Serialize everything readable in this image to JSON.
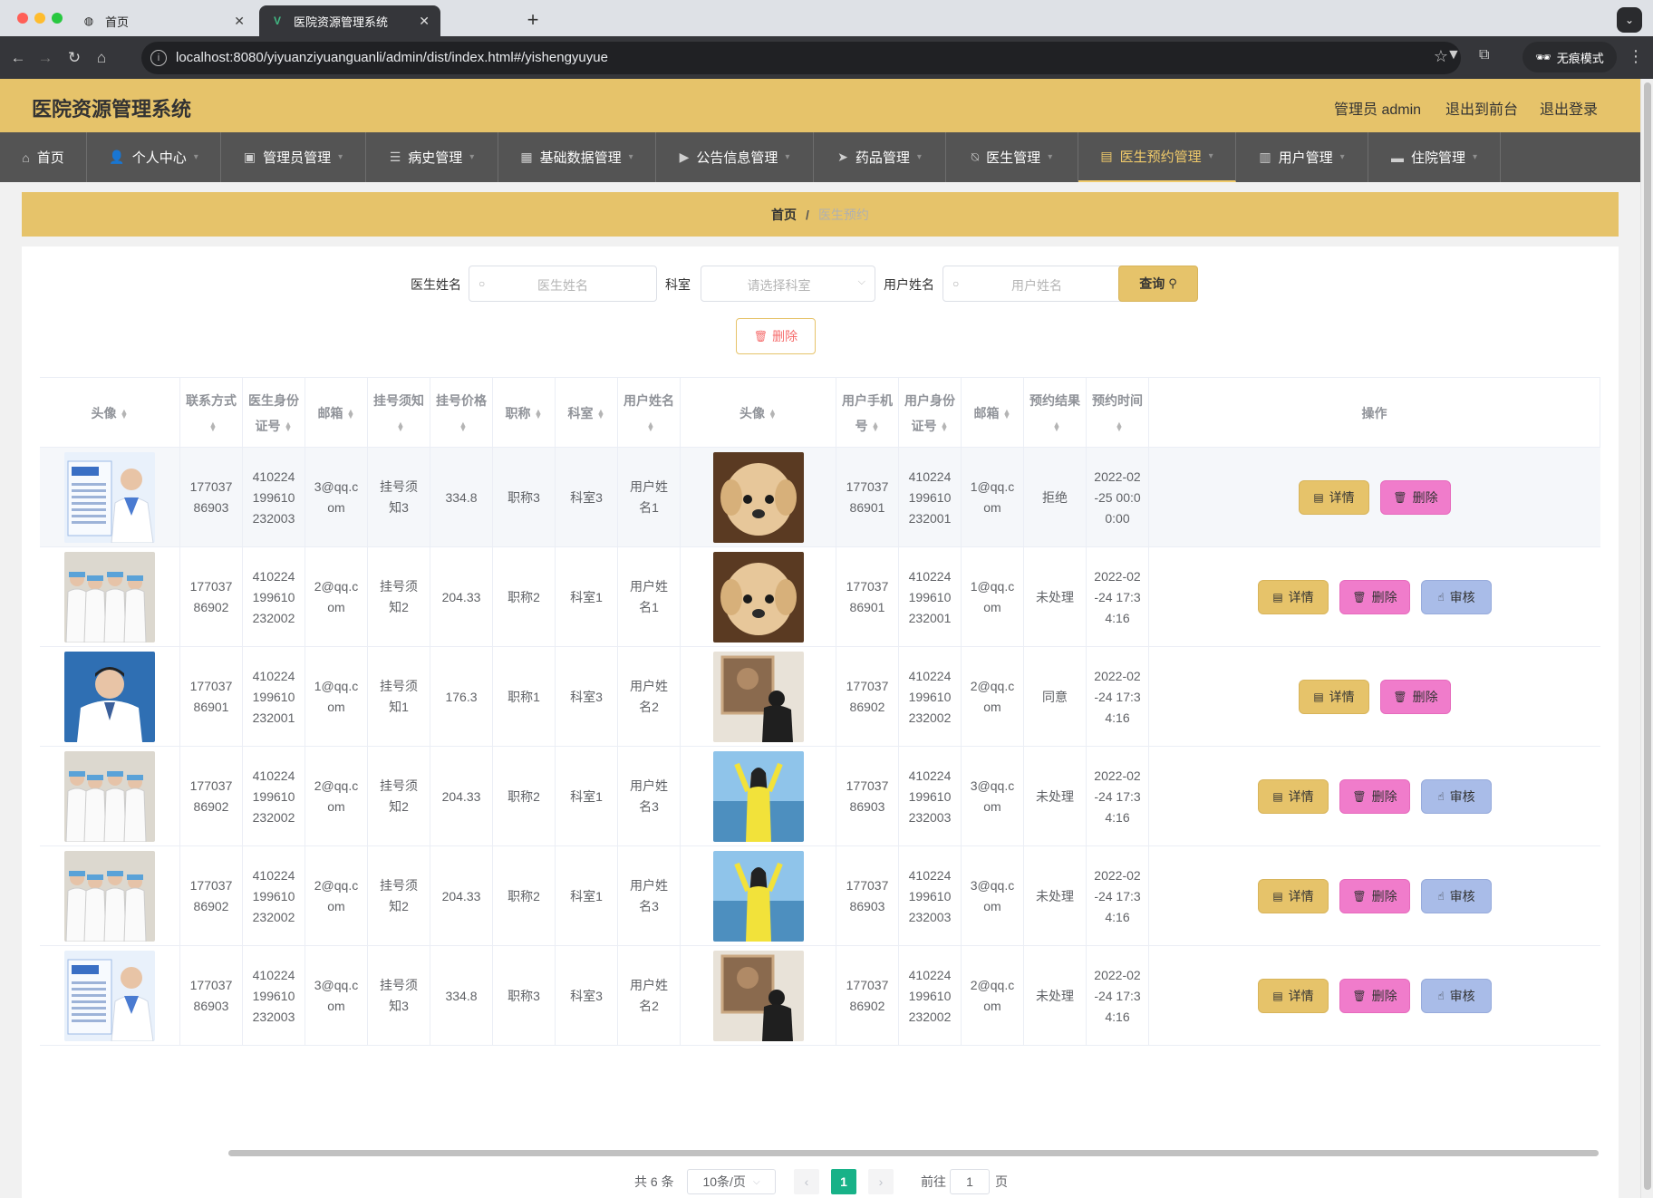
{
  "browser": {
    "tabs": [
      {
        "title": "首页",
        "active": false
      },
      {
        "title": "医院资源管理系统",
        "active": true
      }
    ],
    "url": "localhost:8080/yiyuanziyuanguanli/admin/dist/index.html#/yishengyuyue",
    "incognito_label": "无痕模式"
  },
  "header": {
    "title": "医院资源管理系统",
    "admin_label": "管理员 admin",
    "back_to_front": "退出到前台",
    "logout": "退出登录"
  },
  "nav": {
    "items": [
      {
        "label": "首页",
        "icon": "home-icon",
        "dropdown": false,
        "active": false
      },
      {
        "label": "个人中心",
        "icon": "user-icon",
        "dropdown": true,
        "active": false
      },
      {
        "label": "管理员管理",
        "icon": "admin-icon",
        "dropdown": true,
        "active": false
      },
      {
        "label": "病史管理",
        "icon": "list-icon",
        "dropdown": true,
        "active": false
      },
      {
        "label": "基础数据管理",
        "icon": "grid-icon",
        "dropdown": true,
        "active": false
      },
      {
        "label": "公告信息管理",
        "icon": "video-icon",
        "dropdown": true,
        "active": false
      },
      {
        "label": "药品管理",
        "icon": "send-icon",
        "dropdown": true,
        "active": false
      },
      {
        "label": "医生管理",
        "icon": "bell-off-icon",
        "dropdown": true,
        "active": false
      },
      {
        "label": "医生预约管理",
        "icon": "briefcase-icon",
        "dropdown": true,
        "active": true
      },
      {
        "label": "用户管理",
        "icon": "clipboard-icon",
        "dropdown": true,
        "active": false
      },
      {
        "label": "住院管理",
        "icon": "bed-icon",
        "dropdown": true,
        "active": false
      }
    ]
  },
  "breadcrumb": {
    "home": "首页",
    "separator": "/",
    "current": "医生预约"
  },
  "search": {
    "doctor_name_label": "医生姓名",
    "doctor_name_placeholder": "医生姓名",
    "dept_label": "科室",
    "dept_placeholder": "请选择科室",
    "user_name_label": "用户姓名",
    "user_name_placeholder": "用户姓名",
    "query_label": "查询"
  },
  "bulk_delete_label": "删除",
  "table": {
    "columns": [
      "头像",
      "联系方式",
      "医生身份证号",
      "邮箱",
      "挂号须知",
      "挂号价格",
      "职称",
      "科室",
      "用户姓名",
      "头像",
      "用户手机号",
      "用户身份证号",
      "邮箱",
      "预约结果",
      "预约时间",
      "操作"
    ],
    "actions": {
      "detail": "详情",
      "delete": "删除",
      "audit": "审核"
    },
    "rows": [
      {
        "doctor_avatar": "doctor-portrait-poster",
        "phone": "17703786903",
        "doctor_id": "410224199610232003",
        "email": "3@qq.com",
        "notice": "挂号须知3",
        "price": "334.8",
        "title": "职称3",
        "dept": "科室3",
        "user_name": "用户姓名1",
        "user_avatar": "puppy-photo",
        "user_phone": "17703786901",
        "user_id": "410224199610232001",
        "user_email": "1@qq.com",
        "result": "拒绝",
        "time": "2022-02-25 00:00:00",
        "can_audit": false
      },
      {
        "doctor_avatar": "nurses-group-photo",
        "phone": "17703786902",
        "doctor_id": "410224199610232002",
        "email": "2@qq.com",
        "notice": "挂号须知2",
        "price": "204.33",
        "title": "职称2",
        "dept": "科室1",
        "user_name": "用户姓名1",
        "user_avatar": "puppy-photo",
        "user_phone": "17703786901",
        "user_id": "410224199610232001",
        "user_email": "1@qq.com",
        "result": "未处理",
        "time": "2022-02-24 17:34:16",
        "can_audit": true
      },
      {
        "doctor_avatar": "doctor-blue-portrait",
        "phone": "17703786901",
        "doctor_id": "410224199610232001",
        "email": "1@qq.com",
        "notice": "挂号须知1",
        "price": "176.3",
        "title": "职称1",
        "dept": "科室3",
        "user_name": "用户姓名2",
        "user_avatar": "art-gallery-photo",
        "user_phone": "17703786902",
        "user_id": "410224199610232002",
        "user_email": "2@qq.com",
        "result": "同意",
        "time": "2022-02-24 17:34:16",
        "can_audit": false
      },
      {
        "doctor_avatar": "nurses-group-photo",
        "phone": "17703786902",
        "doctor_id": "410224199610232002",
        "email": "2@qq.com",
        "notice": "挂号须知2",
        "price": "204.33",
        "title": "职称2",
        "dept": "科室1",
        "user_name": "用户姓名3",
        "user_avatar": "beach-girl-photo",
        "user_phone": "17703786903",
        "user_id": "410224199610232003",
        "user_email": "3@qq.com",
        "result": "未处理",
        "time": "2022-02-24 17:34:16",
        "can_audit": true
      },
      {
        "doctor_avatar": "nurses-group-photo",
        "phone": "17703786902",
        "doctor_id": "410224199610232002",
        "email": "2@qq.com",
        "notice": "挂号须知2",
        "price": "204.33",
        "title": "职称2",
        "dept": "科室1",
        "user_name": "用户姓名3",
        "user_avatar": "beach-girl-photo",
        "user_phone": "17703786903",
        "user_id": "410224199610232003",
        "user_email": "3@qq.com",
        "result": "未处理",
        "time": "2022-02-24 17:34:16",
        "can_audit": true
      },
      {
        "doctor_avatar": "doctor-portrait-poster",
        "phone": "17703786903",
        "doctor_id": "410224199610232003",
        "email": "3@qq.com",
        "notice": "挂号须知3",
        "price": "334.8",
        "title": "职称3",
        "dept": "科室3",
        "user_name": "用户姓名2",
        "user_avatar": "art-gallery-photo",
        "user_phone": "17703786902",
        "user_id": "410224199610232002",
        "user_email": "2@qq.com",
        "result": "未处理",
        "time": "2022-02-24 17:34:16",
        "can_audit": true
      }
    ]
  },
  "pagination": {
    "total_label": "共 6 条",
    "page_size": "10条/页",
    "current_page": "1",
    "goto_label": "前往",
    "goto_value": "1",
    "page_suffix": "页"
  },
  "colors": {
    "accent": "#e6c36a",
    "nav_bg": "#545454",
    "delete": "#f07ccb",
    "audit": "#a9bce8",
    "page_active": "#18b288"
  }
}
